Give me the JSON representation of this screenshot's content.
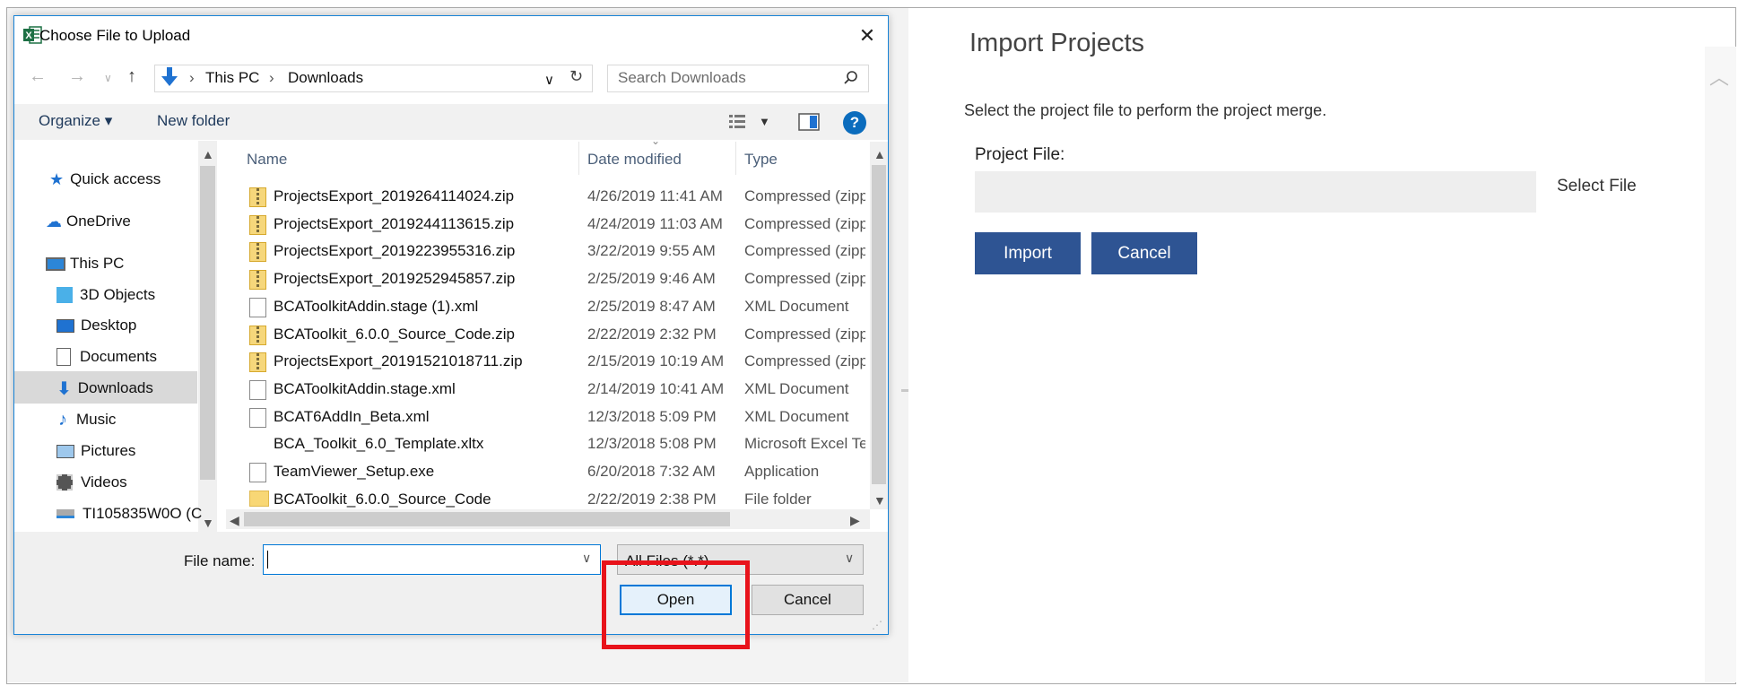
{
  "dialog": {
    "title": "Choose File to Upload",
    "close": "✕",
    "address": {
      "this_pc": "This PC",
      "folder": "Downloads"
    },
    "search_placeholder": "Search Downloads",
    "toolbar": {
      "organize": "Organize ▾",
      "new_folder": "New folder",
      "help": "?"
    },
    "nav": [
      {
        "label": "Quick access"
      },
      {
        "label": "OneDrive"
      },
      {
        "label": "This PC"
      },
      {
        "label": "3D Objects"
      },
      {
        "label": "Desktop"
      },
      {
        "label": "Documents"
      },
      {
        "label": "Downloads",
        "selected": true
      },
      {
        "label": "Music"
      },
      {
        "label": "Pictures"
      },
      {
        "label": "Videos"
      },
      {
        "label": "TI105835W0O (C"
      }
    ],
    "columns": {
      "name": "Name",
      "date": "Date modified",
      "type": "Type"
    },
    "files": [
      {
        "name": "ProjectsExport_2019264114024.zip",
        "date": "4/26/2019 11:41 AM",
        "type": "Compressed (zipp",
        "icon": "zip"
      },
      {
        "name": "ProjectsExport_2019244113615.zip",
        "date": "4/24/2019 11:03 AM",
        "type": "Compressed (zipp",
        "icon": "zip"
      },
      {
        "name": "ProjectsExport_2019223955316.zip",
        "date": "3/22/2019 9:55 AM",
        "type": "Compressed (zipp",
        "icon": "zip"
      },
      {
        "name": "ProjectsExport_2019252945857.zip",
        "date": "2/25/2019 9:46 AM",
        "type": "Compressed (zipp",
        "icon": "zip"
      },
      {
        "name": "BCAToolkitAddin.stage (1).xml",
        "date": "2/25/2019 8:47 AM",
        "type": "XML Document",
        "icon": "doc"
      },
      {
        "name": "BCAToolkit_6.0.0_Source_Code.zip",
        "date": "2/22/2019 2:32 PM",
        "type": "Compressed (zipp",
        "icon": "zip"
      },
      {
        "name": "ProjectsExport_20191521018711.zip",
        "date": "2/15/2019 10:19 AM",
        "type": "Compressed (zipp",
        "icon": "zip"
      },
      {
        "name": "BCAToolkitAddin.stage.xml",
        "date": "2/14/2019 10:41 AM",
        "type": "XML Document",
        "icon": "doc"
      },
      {
        "name": "BCAT6AddIn_Beta.xml",
        "date": "12/3/2018 5:09 PM",
        "type": "XML Document",
        "icon": "doc"
      },
      {
        "name": "BCA_Toolkit_6.0_Template.xltx",
        "date": "12/3/2018 5:08 PM",
        "type": "Microsoft Excel Te",
        "icon": "excel"
      },
      {
        "name": "TeamViewer_Setup.exe",
        "date": "6/20/2018 7:32 AM",
        "type": "Application",
        "icon": "doc"
      },
      {
        "name": "BCAToolkit_6.0.0_Source_Code",
        "date": "2/22/2019 2:38 PM",
        "type": "File folder",
        "icon": "folder"
      }
    ],
    "file_name_label": "File name:",
    "file_name_value": "",
    "file_type": "All Files (*.*)",
    "open_label": "Open",
    "cancel_label": "Cancel"
  },
  "web": {
    "title": "Import Projects",
    "description": "Select the project file to perform the project merge.",
    "project_file_label": "Project File:",
    "select_file_label": "Select File",
    "import_label": "Import",
    "cancel_label": "Cancel"
  },
  "colors": {
    "accent": "#0078d7",
    "brand_button": "#2e5493",
    "highlight": "#e8131b"
  }
}
